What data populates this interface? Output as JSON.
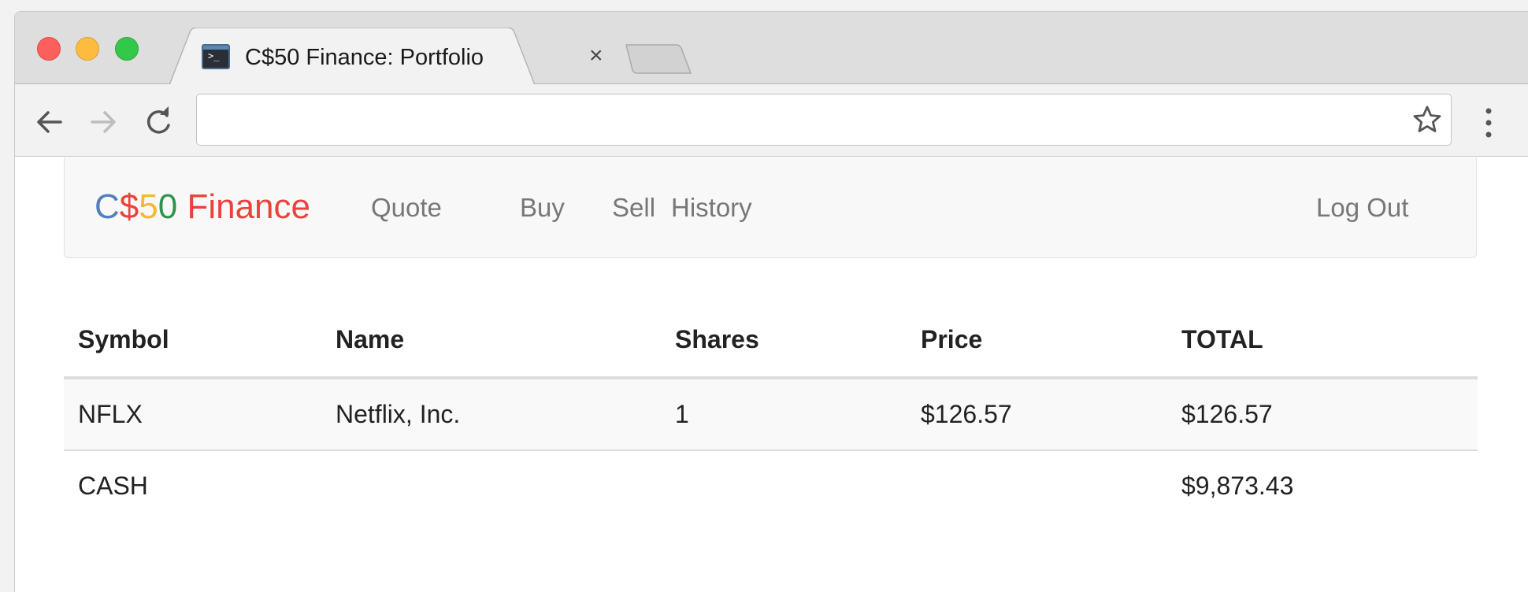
{
  "browser": {
    "tab_title": "C$50 Finance: Portfolio",
    "tab_close": "×",
    "favicon_glyph": ">_",
    "url_value": "",
    "colors": {
      "close": "#fc605c",
      "minimize": "#fdbc40",
      "maximize": "#34c84a"
    }
  },
  "toolbar": {
    "icons": [
      "back-arrow-icon",
      "forward-arrow-icon",
      "reload-icon",
      "star-icon",
      "menu-dots-icon"
    ]
  },
  "navbar": {
    "brand": {
      "parts": [
        {
          "text": "C",
          "color": "#537fbe"
        },
        {
          "text": "$",
          "color": "#ea433b"
        },
        {
          "text": "5",
          "color": "#f5b82e"
        },
        {
          "text": "0",
          "color": "#2e944b"
        },
        {
          "text": " Finance",
          "color": "#ea433b"
        }
      ]
    },
    "links": {
      "quote": "Quote",
      "buy": "Buy",
      "sell": "Sell",
      "history": "History",
      "logout": "Log Out"
    }
  },
  "portfolio": {
    "headers": [
      "Symbol",
      "Name",
      "Shares",
      "Price",
      "TOTAL"
    ],
    "rows": [
      {
        "symbol": "NFLX",
        "name": "Netflix, Inc.",
        "shares": "1",
        "price": "$126.57",
        "total": "$126.57"
      }
    ],
    "cash": {
      "label": "CASH",
      "total": "$9,873.43"
    }
  }
}
